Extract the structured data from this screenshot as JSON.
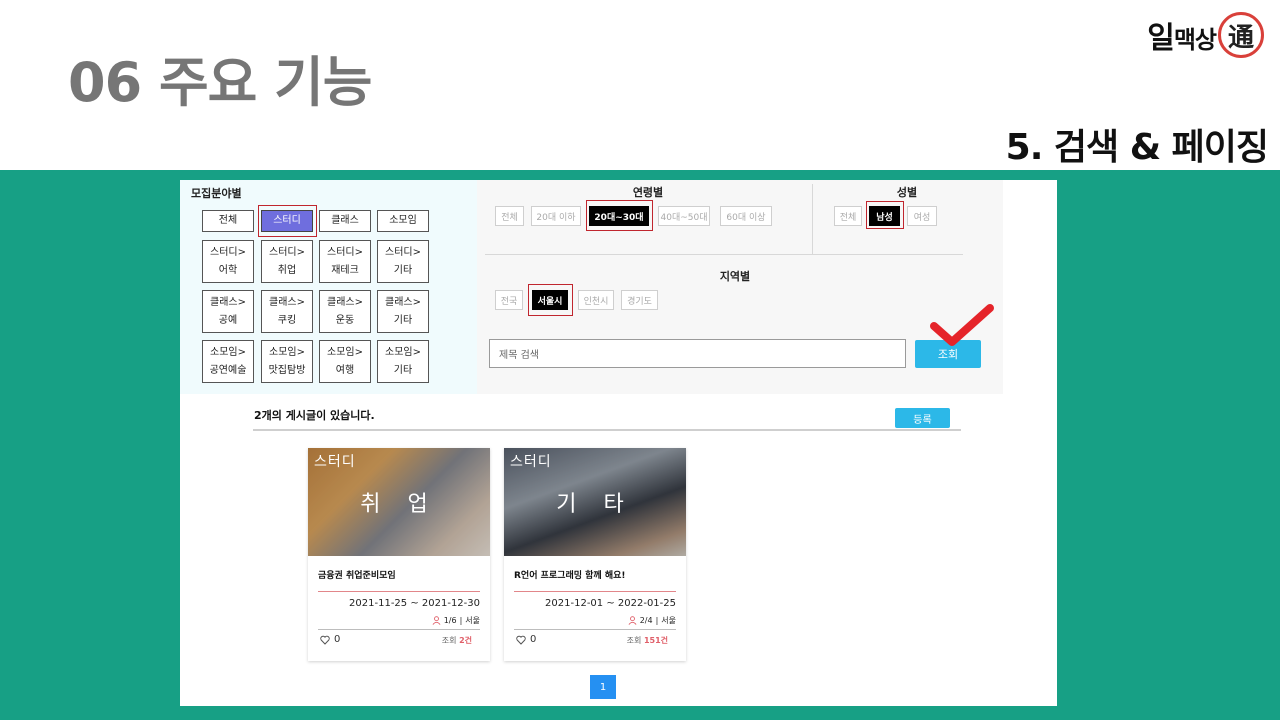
{
  "slide": {
    "title": "06 주요 기능",
    "section": "5. 검색 & 페이징",
    "logo": {
      "main": "일",
      "small": "맥상",
      "seal": "通"
    }
  },
  "category_panel": {
    "label": "모집분야별",
    "rows": [
      [
        {
          "l1": "전체"
        },
        {
          "l1": "스터디",
          "active": true
        },
        {
          "l1": "클래스"
        },
        {
          "l1": "소모임"
        }
      ],
      [
        {
          "l1": "스터디>",
          "l2": "어학"
        },
        {
          "l1": "스터디>",
          "l2": "취업"
        },
        {
          "l1": "스터디>",
          "l2": "재테크"
        },
        {
          "l1": "스터디>",
          "l2": "기타"
        }
      ],
      [
        {
          "l1": "클래스>",
          "l2": "공예"
        },
        {
          "l1": "클래스>",
          "l2": "쿠킹"
        },
        {
          "l1": "클래스>",
          "l2": "운동"
        },
        {
          "l1": "클래스>",
          "l2": "기타"
        }
      ],
      [
        {
          "l1": "소모임>",
          "l2": "공연예술"
        },
        {
          "l1": "소모임>",
          "l2": "맛집탐방"
        },
        {
          "l1": "소모임>",
          "l2": "여행"
        },
        {
          "l1": "소모임>",
          "l2": "기타"
        }
      ]
    ]
  },
  "age_filter": {
    "label": "연령별",
    "options": [
      "전체",
      "20대 이하",
      "20대~30대",
      "40대~50대",
      "60대 이상"
    ],
    "selected": "20대~30대"
  },
  "gender_filter": {
    "label": "성별",
    "options": [
      "전체",
      "남성",
      "여성"
    ],
    "selected": "남성"
  },
  "region_filter": {
    "label": "지역별",
    "options": [
      "전국",
      "서울시",
      "인천시",
      "경기도"
    ],
    "selected": "서울시"
  },
  "search": {
    "placeholder": "제목 검색",
    "button": "조회"
  },
  "results": {
    "count_text": "2개의 게시글이 있습니다.",
    "register_button": "등록"
  },
  "cards": [
    {
      "category": "스터디",
      "subcategory": "취 업",
      "title": "금융권 취업준비모임",
      "dates": "2021-11-25 ~ 2021-12-30",
      "members": "1/6",
      "separator": "|",
      "region": "서울",
      "likes": "0",
      "views_label": "조회",
      "views": "2건"
    },
    {
      "category": "스터디",
      "subcategory": "기 타",
      "title": "R언어 프로그래밍 함께 해요!",
      "dates": "2021-12-01 ~ 2022-01-25",
      "members": "2/4",
      "separator": "|",
      "region": "서울",
      "likes": "0",
      "views_label": "조회",
      "views": "151건"
    }
  ],
  "pagination": {
    "current": "1"
  },
  "colors": {
    "teal": "#17a085",
    "active_category": "#6f6ede",
    "accent_blue": "#2cb8e8",
    "page_blue": "#2590f2",
    "highlight_red": "#c0262e",
    "check_red": "#e5242a"
  }
}
